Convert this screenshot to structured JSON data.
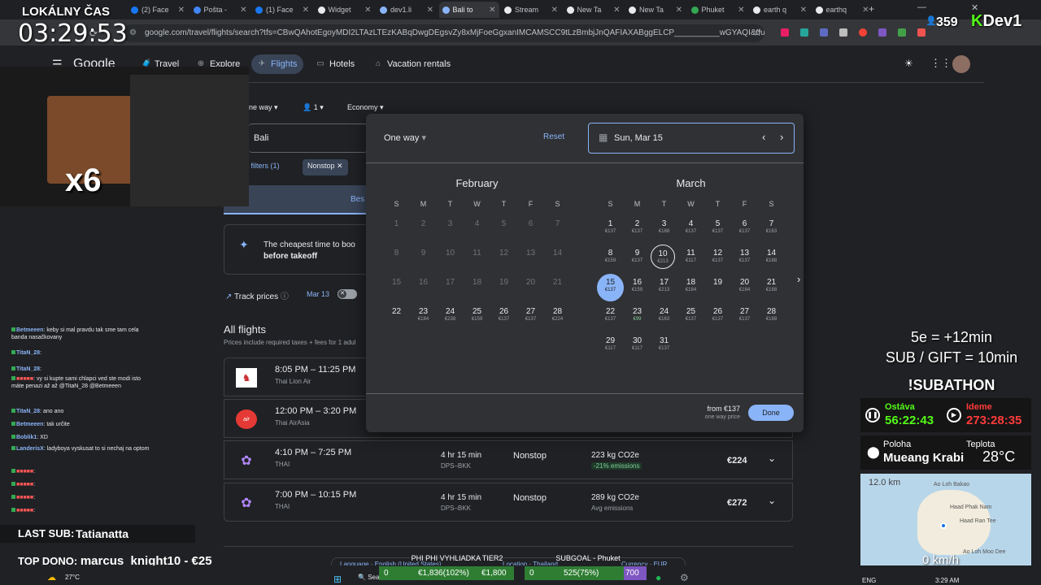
{
  "browser": {
    "tabs": [
      {
        "label": "(2) Face",
        "icon": "facebook-icon",
        "color": "#1877f2"
      },
      {
        "label": "Pošta -",
        "icon": "mail-icon",
        "color": "#4285f4"
      },
      {
        "label": "(1) Face",
        "icon": "facebook-icon",
        "color": "#1877f2"
      },
      {
        "label": "Widget",
        "icon": "widget-icon",
        "color": "#e8eaed"
      },
      {
        "label": "dev1.li",
        "icon": "page-icon",
        "color": "#8ab4f8"
      },
      {
        "label": "Bali to",
        "icon": "flights-icon",
        "color": "#8ab4f8"
      },
      {
        "label": "Stream",
        "icon": "stream-icon",
        "color": "#e8eaed"
      },
      {
        "label": "New Ta",
        "icon": "chrome-icon",
        "color": "#e8eaed"
      },
      {
        "label": "New Ta",
        "icon": "chrome-icon",
        "color": "#e8eaed"
      },
      {
        "label": "Phuket",
        "icon": "maps-icon",
        "color": "#34a853"
      },
      {
        "label": "earth q",
        "icon": "google-icon",
        "color": "#e8eaed"
      },
      {
        "label": "earthq",
        "icon": "google-icon",
        "color": "#e8eaed"
      }
    ],
    "new_tab": "+",
    "url": "google.com/travel/flights/search?tfs=CBwQAhotEgoyMDI2LTAzLTEzKABqDwgDEgsvZy8xMjFoeGgxanIMCAMSCC9tLzBmbjJnQAFIAXABggELCP__________wGYAQI&tfu=EgYIA..."
  },
  "header": {
    "logo": "Google",
    "nav": [
      {
        "label": "Travel",
        "icon": "travel-icon"
      },
      {
        "label": "Explore",
        "icon": "explore-icon"
      },
      {
        "label": "Flights",
        "icon": "flights-icon"
      },
      {
        "label": "Hotels",
        "icon": "hotels-icon"
      },
      {
        "label": "Vacation rentals",
        "icon": "vacation-icon"
      }
    ]
  },
  "search": {
    "trip_type": "ne way",
    "passengers": "1",
    "cabin": "Economy",
    "origin": "Bali",
    "filters": "ll filters (1)",
    "nonstop_chip": "Nonstop",
    "best_tab": "Bes"
  },
  "insight": {
    "line1": "The cheapest time to boo",
    "line2": "before takeoff"
  },
  "track": {
    "label": "Track prices",
    "date": "Mar 13"
  },
  "results": {
    "title": "All flights",
    "subtitle": "Prices include required taxes + fees for 1 adul",
    "flights": [
      {
        "time": "8:05 PM – 11:25 PM",
        "airline": "Thai Lion Air",
        "duration": "",
        "route": "",
        "stops": "",
        "co2": "",
        "emissions": "",
        "price": "",
        "logo": "thai-lion-air-logo"
      },
      {
        "time": "12:00 PM – 3:20 PM",
        "airline": "Thai AirAsia",
        "duration": "",
        "route": "",
        "stops": "",
        "co2": "",
        "emissions": "",
        "price": "",
        "logo": "airasia-logo"
      },
      {
        "time": "4:10 PM – 7:25 PM",
        "airline": "THAI",
        "duration": "4 hr 15 min",
        "route": "DPS–BKK",
        "stops": "Nonstop",
        "co2": "223 kg CO2e",
        "emissions": "-21% emissions",
        "price": "€224",
        "logo": "thai-logo"
      },
      {
        "time": "7:00 PM – 10:15 PM",
        "airline": "THAI",
        "duration": "4 hr 15 min",
        "route": "DPS–BKK",
        "stops": "Nonstop",
        "co2": "289 kg CO2e",
        "emissions": "Avg emissions",
        "price": "€272",
        "logo": "thai-logo"
      }
    ]
  },
  "picker": {
    "trip_type": "One way",
    "reset": "Reset",
    "date": "Sun, Mar 15",
    "from_label": "from €137",
    "from_sub": "one way price",
    "done": "Done",
    "dow": [
      "S",
      "M",
      "T",
      "W",
      "T",
      "F",
      "S"
    ],
    "months": [
      {
        "name": "February",
        "start": 0,
        "days": [
          {
            "d": "1"
          },
          {
            "d": "2"
          },
          {
            "d": "3"
          },
          {
            "d": "4"
          },
          {
            "d": "5"
          },
          {
            "d": "6"
          },
          {
            "d": "7"
          },
          {
            "d": "8"
          },
          {
            "d": "9"
          },
          {
            "d": "10"
          },
          {
            "d": "11"
          },
          {
            "d": "12"
          },
          {
            "d": "13"
          },
          {
            "d": "14"
          },
          {
            "d": "15"
          },
          {
            "d": "16"
          },
          {
            "d": "17"
          },
          {
            "d": "18"
          },
          {
            "d": "19"
          },
          {
            "d": "20"
          },
          {
            "d": "21"
          },
          {
            "d": "22",
            "p": ""
          },
          {
            "d": "23",
            "p": "€184"
          },
          {
            "d": "24",
            "p": "€238"
          },
          {
            "d": "25",
            "p": "€159"
          },
          {
            "d": "26",
            "p": "€137"
          },
          {
            "d": "27",
            "p": "€137"
          },
          {
            "d": "28",
            "p": "€224"
          }
        ]
      },
      {
        "name": "March",
        "start": 0,
        "days": [
          {
            "d": "1",
            "p": "€137"
          },
          {
            "d": "2",
            "p": "€137"
          },
          {
            "d": "3",
            "p": "€188"
          },
          {
            "d": "4",
            "p": "€137"
          },
          {
            "d": "5",
            "p": "€137"
          },
          {
            "d": "6",
            "p": "€137"
          },
          {
            "d": "7",
            "p": "€163"
          },
          {
            "d": "8",
            "p": "€159"
          },
          {
            "d": "9",
            "p": "€137"
          },
          {
            "d": "10",
            "p": "€213"
          },
          {
            "d": "11",
            "p": "€117"
          },
          {
            "d": "12",
            "p": "€137"
          },
          {
            "d": "13",
            "p": "€137"
          },
          {
            "d": "14",
            "p": "€188"
          },
          {
            "d": "15",
            "p": "€137"
          },
          {
            "d": "16",
            "p": "€159"
          },
          {
            "d": "17",
            "p": "€213"
          },
          {
            "d": "18",
            "p": "€184"
          },
          {
            "d": "19",
            "p": ""
          },
          {
            "d": "20",
            "p": "€184"
          },
          {
            "d": "21",
            "p": "€188"
          },
          {
            "d": "22",
            "p": "€137"
          },
          {
            "d": "23",
            "p": "€99"
          },
          {
            "d": "24",
            "p": "€163"
          },
          {
            "d": "25",
            "p": "€137"
          },
          {
            "d": "26",
            "p": "€137"
          },
          {
            "d": "27",
            "p": "€137"
          },
          {
            "d": "28",
            "p": "€188"
          },
          {
            "d": "29",
            "p": "€117"
          },
          {
            "d": "30",
            "p": "€117"
          },
          {
            "d": "31",
            "p": "€137"
          }
        ]
      }
    ]
  },
  "stream": {
    "clock_label": "LOKÁLNY ČAS",
    "clock": "03:29:53",
    "viewers": "359",
    "channel": "Dev1",
    "multiplier": "x6",
    "chat": [
      {
        "user": "Betmeeen",
        "msg": ": keby si mal pravdu tak sme tam cela banda nasačkovany"
      },
      {
        "user": "TitaN_28",
        "msg": ":"
      },
      {
        "user": "TitaN_28",
        "msg": ":"
      },
      {
        "user": "",
        "msg": ": vy si kupte sami chlapci ved ste modi isto máte penazi až až @TitaN_28 @Betmeeen"
      },
      {
        "user": "TitaN_28",
        "msg": ": ano ano"
      },
      {
        "user": "Betmeeen",
        "msg": ": tak určite"
      },
      {
        "user": "Boblik1",
        "msg": ": XD"
      },
      {
        "user": "LanderisX",
        "msg": ": ladyboya vyskusat to si nechaj na optom"
      },
      {
        "user": "",
        "msg": ":"
      },
      {
        "user": "",
        "msg": ":"
      },
      {
        "user": "",
        "msg": ":"
      },
      {
        "user": "",
        "msg": ":"
      }
    ],
    "last_sub_label": "LAST SUB:",
    "last_sub": "Tatianatta",
    "top_dono_label": "TOP DONO:",
    "top_dono": "marcus_knight10 - €25",
    "rule1": "5e = +12min",
    "rule2": "SUB / GIFT = 10min",
    "subathon": "!SUBATHON",
    "remaining_label": "Ostáva",
    "remaining": "56:22:43",
    "elapsed_label": "Ideme",
    "elapsed": "273:28:35",
    "location_label": "Poloha",
    "location": "Mueang Krabi",
    "temp_label": "Teplota",
    "temp": "28°C",
    "map_distance": "12.0 km",
    "map_speed": "0 km/h",
    "map_places": [
      "Ao Loh Bakao",
      "Haad Phak Nam",
      "Haad Ran Tee",
      "Ao Loh Moo Dee"
    ]
  },
  "bottom": {
    "tier": "PHI PHI VYHLIADKA TIER2",
    "subgoal": "SUBGOAL - Phuket",
    "language": "Language · English (United States)",
    "location": "Location · Thailand",
    "currency": "Currency · EUR",
    "bar1_left": "0",
    "bar1_mid": "€1,836(102%)",
    "bar1_right": "€1,800",
    "bar2_left": "0",
    "bar2_mid": "525(75%)",
    "bar2_right": "700",
    "weather": "27°C",
    "search": "Search",
    "lang": "ENG",
    "time": "3:29 AM"
  }
}
